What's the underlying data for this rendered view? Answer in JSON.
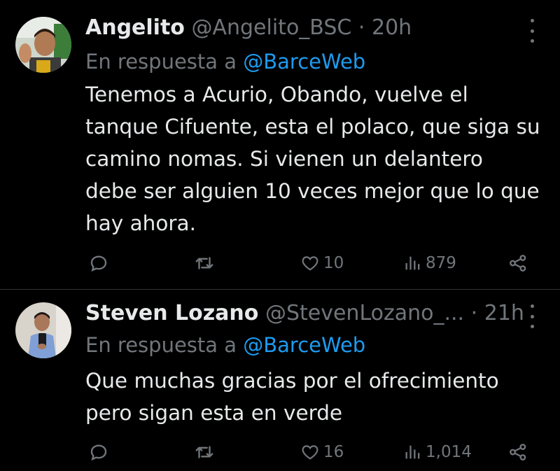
{
  "tweets": [
    {
      "name": "Angelito",
      "handle": "@Angelito_BSC",
      "separator": "·",
      "time": "20h",
      "reply_prefix": "En respuesta a",
      "reply_to": "@BarceWeb",
      "text": "Tenemos a Acurio, Obando, vuelve el tanque Cifuente, esta el polaco, que siga su camino nomas. Si vienen un delantero debe ser alguien 10 veces mejor que lo que hay ahora.",
      "likes": "10",
      "views": "879"
    },
    {
      "name": "Steven Lozano",
      "handle": "@StevenLozano_...",
      "separator": "·",
      "time": "21h",
      "reply_prefix": "En respuesta a",
      "reply_to": "@BarceWeb",
      "text": "Que muchas gracias por el ofrecimiento pero sigan esta en verde",
      "likes": "16",
      "views": "1,014"
    }
  ],
  "icons": {
    "reply": "reply-icon",
    "retweet": "retweet-icon",
    "like": "heart-icon",
    "views": "views-icon",
    "share": "share-icon",
    "more": "more-icon"
  },
  "colors": {
    "background": "#000000",
    "text": "#e7e9ea",
    "muted": "#71767b",
    "link": "#1d9bf0",
    "divider": "#2f3336"
  }
}
